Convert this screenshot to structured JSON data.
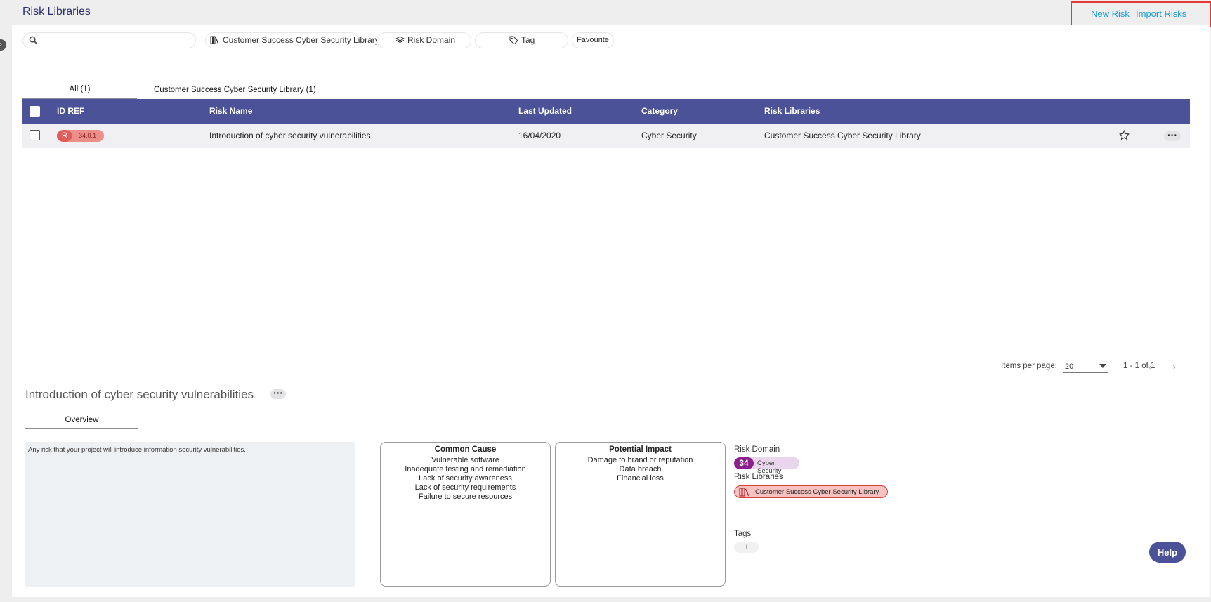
{
  "header": {
    "title": "Risk Libraries",
    "new_risk": "New Risk",
    "import_risks": "Import Risks"
  },
  "filters": {
    "search_placeholder": "",
    "library_chip": "Customer Success Cyber Security Library",
    "domain_chip": "Risk Domain",
    "tag_chip": "Tag",
    "favourite_chip": "Favourite"
  },
  "tabs": [
    {
      "label": "All (1)",
      "active": true
    },
    {
      "label": "Customer Success Cyber Security Library (1)",
      "active": false
    }
  ],
  "table": {
    "columns": [
      "ID REF",
      "Risk Name",
      "Last Updated",
      "Category",
      "Risk Libraries"
    ],
    "rows": [
      {
        "id_badge": "R",
        "id_ref": "34.0.1",
        "risk_name": "Introduction of cyber security vulnerabilities",
        "last_updated": "16/04/2020",
        "category": "Cyber Security",
        "risk_libraries": "Customer Success Cyber Security Library"
      }
    ]
  },
  "pagination": {
    "items_label": "Items per page:",
    "items_per_page": "20",
    "range": "1 - 1 of 1",
    "prev": "‹",
    "next": "›"
  },
  "detail": {
    "title": "Introduction of cyber security vulnerabilities",
    "tab_overview": "Overview",
    "description": "Any risk that your project will introduce information security vulnerabilities.",
    "common_cause": {
      "title": "Common Cause",
      "items": [
        "Vulnerable software",
        "Inadequate testing and remediation",
        "Lack of security awareness",
        "Lack of security requirements",
        "Failure to secure resources"
      ]
    },
    "potential_impact": {
      "title": "Potential Impact",
      "items": [
        "Damage to brand or reputation",
        "Data breach",
        "Financial loss"
      ]
    },
    "risk_domain_label": "Risk Domain",
    "risk_domain_num": "34",
    "risk_domain_name": "Cyber Security",
    "risk_libraries_label": "Risk Libraries",
    "risk_library_name": "Customer Success Cyber Security Library",
    "tags_label": "Tags",
    "tag_add": "+"
  },
  "help": "Help",
  "colors": {
    "brand": "#4b5297",
    "link": "#1a9bd7",
    "highlight_border": "#e53935",
    "risk_badge": "#e25b5b",
    "domain_badge": "#8b1f8b"
  }
}
